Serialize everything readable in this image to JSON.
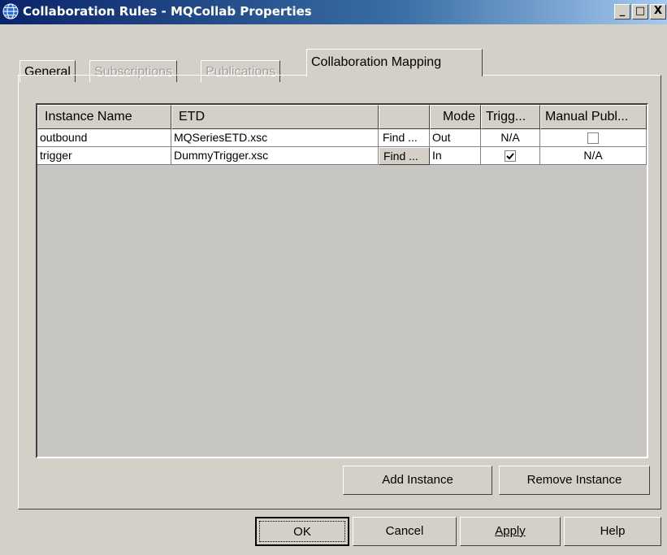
{
  "window": {
    "title": "Collaboration Rules - MQCollab Properties",
    "minimize": "_",
    "maximize": "□",
    "close": "X"
  },
  "tabs": [
    {
      "label": "General",
      "state": "enabled"
    },
    {
      "label": "Subscriptions",
      "state": "disabled"
    },
    {
      "label": "Publications",
      "state": "disabled"
    },
    {
      "label": "Collaboration Mapping",
      "state": "active"
    }
  ],
  "table": {
    "columns": [
      "Instance Name",
      "ETD",
      "",
      "Mode",
      "Trigg...",
      "Manual Publ..."
    ],
    "rows": [
      {
        "instance": "outbound",
        "etd": "MQSeriesETD.xsc",
        "find": "Find ...",
        "mode": "Out",
        "trigger": "N/A",
        "manual": "checkbox",
        "manual_checked": false
      },
      {
        "instance": "trigger",
        "etd": "DummyTrigger.xsc",
        "find": "Find ...",
        "mode": "In",
        "trigger": "checkbox",
        "trigger_checked": true,
        "manual": "N/A"
      }
    ]
  },
  "buttons": {
    "add_instance": "Add Instance",
    "remove_instance": "Remove Instance",
    "ok": "OK",
    "cancel": "Cancel",
    "apply": "Apply",
    "help": "Help"
  }
}
